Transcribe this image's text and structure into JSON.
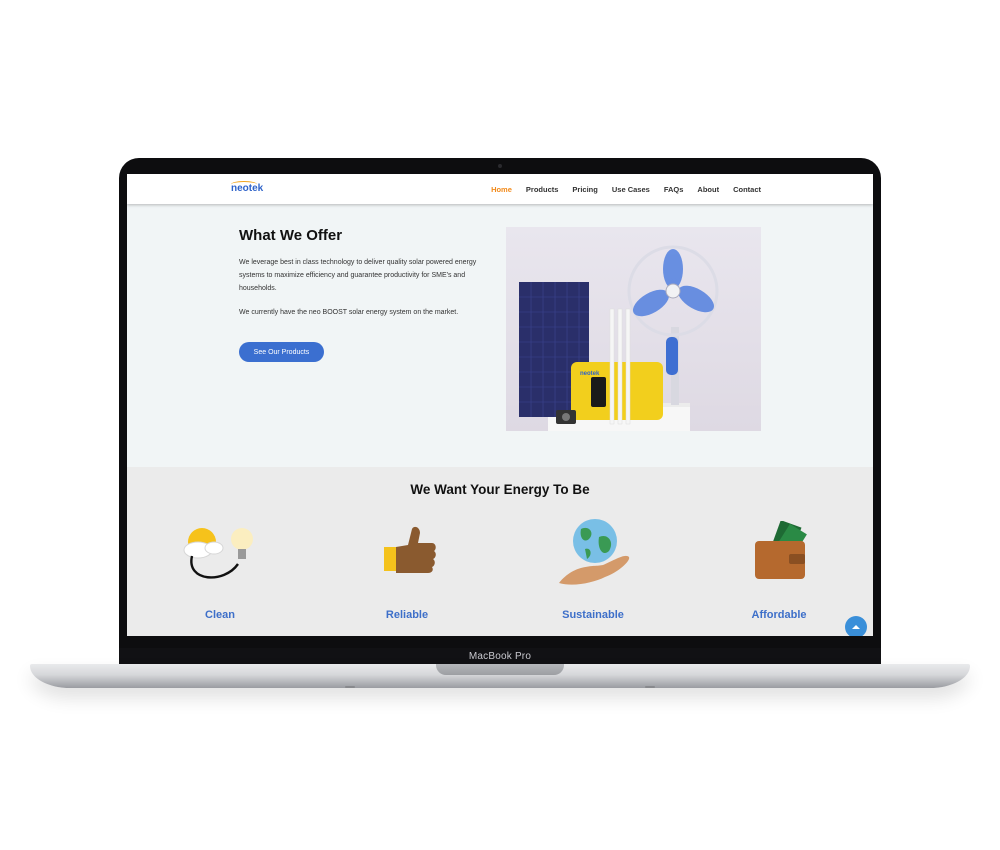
{
  "device": {
    "label": "MacBook Pro"
  },
  "nav": {
    "logo": "neotek",
    "items": [
      {
        "label": "Home",
        "active": true
      },
      {
        "label": "Products",
        "active": false
      },
      {
        "label": "Pricing",
        "active": false
      },
      {
        "label": "Use Cases",
        "active": false
      },
      {
        "label": "FAQs",
        "active": false
      },
      {
        "label": "About",
        "active": false
      },
      {
        "label": "Contact",
        "active": false
      }
    ]
  },
  "offer": {
    "title": "What We Offer",
    "paragraph1": "We leverage best in class technology to deliver quality solar powered energy systems to maximize efficiency and guarantee productivity for SME's and households.",
    "paragraph2": "We currently have the neo BOOST solar energy system on the market.",
    "cta_label": "See Our Products",
    "product_device_label": "neotek"
  },
  "energy": {
    "title": "We Want Your Energy To Be",
    "features": [
      {
        "label": "Clean",
        "icon": "sun-cloud-bulb-icon"
      },
      {
        "label": "Reliable",
        "icon": "thumbs-up-icon"
      },
      {
        "label": "Sustainable",
        "icon": "globe-in-hand-icon"
      },
      {
        "label": "Affordable",
        "icon": "wallet-cash-icon"
      }
    ]
  },
  "colors": {
    "accent": "#f28a1a",
    "brand_blue": "#3b6fd0",
    "feature_label": "#3d6fc9",
    "section_bg": "#ebebeb"
  }
}
